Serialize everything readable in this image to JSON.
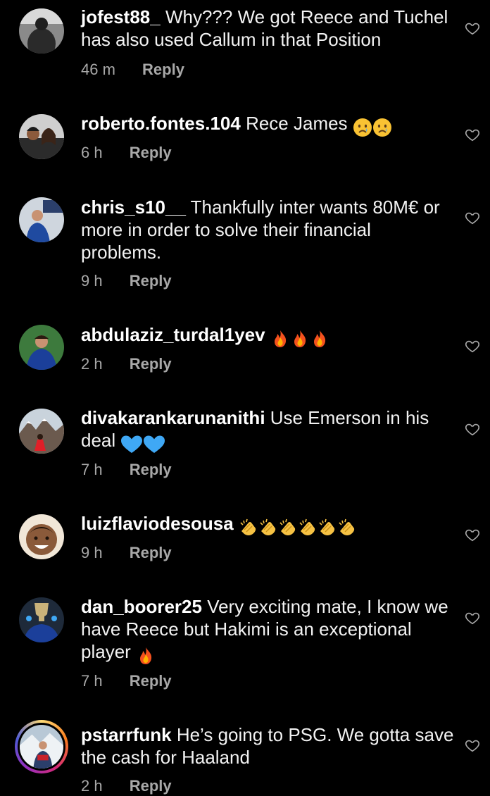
{
  "comments": [
    {
      "username": "jofest88_",
      "text": "Why??? We got Reece and Tuchel has also used Callum in that Position",
      "emoji": [],
      "time": "46 m",
      "reply": "Reply"
    },
    {
      "username": "roberto.fontes.104",
      "text": "Rece James",
      "emoji": [
        "crying-face-emoji",
        "crying-face-emoji"
      ],
      "time": "6 h",
      "reply": "Reply"
    },
    {
      "username": "chris_s10__",
      "text": "Thankfully inter wants 80M€ or more in order to  solve their financial problems.",
      "emoji": [],
      "time": "9 h",
      "reply": "Reply"
    },
    {
      "username": "abdulaziz_turdal1yev",
      "text": "",
      "emoji": [
        "fire-emoji",
        "fire-emoji",
        "fire-emoji"
      ],
      "time": "2 h",
      "reply": "Reply"
    },
    {
      "username": "divakarankarunanithi",
      "text": "Use Emerson in his deal",
      "emoji": [
        "blue-heart-emoji",
        "blue-heart-emoji"
      ],
      "time": "7 h",
      "reply": "Reply"
    },
    {
      "username": "luizflaviodesousa",
      "text": "",
      "emoji": [
        "clapping-hands-emoji",
        "clapping-hands-emoji",
        "clapping-hands-emoji",
        "clapping-hands-emoji",
        "clapping-hands-emoji",
        "clapping-hands-emoji"
      ],
      "time": "9 h",
      "reply": "Reply"
    },
    {
      "username": "dan_boorer25",
      "text": "Very exciting mate, I know we have Reece but Hakimi is an exceptional player",
      "emoji": [
        "fire-emoji"
      ],
      "time": "7 h",
      "reply": "Reply"
    },
    {
      "username": "pstarrfunk",
      "text": "He’s going to PSG. We gotta save the cash for Haaland",
      "emoji": [],
      "time": "2 h",
      "reply": "Reply"
    }
  ],
  "colors": {
    "background": "#000000",
    "text": "#f2f2f2",
    "meta": "#a8a8a8"
  }
}
